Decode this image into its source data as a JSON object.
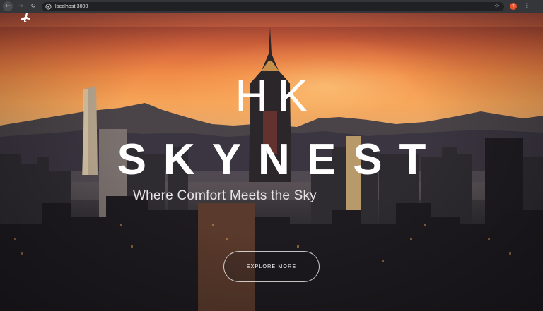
{
  "browser": {
    "url": "localhost:3000",
    "profile_initial": "T",
    "icons": [
      "back-arrow-icon",
      "forward-arrow-icon",
      "reload-icon",
      "site-info-icon",
      "star-icon",
      "profile-avatar",
      "more-menu-icon"
    ],
    "profile_color": "#e8542e"
  },
  "hero": {
    "title_line1": "HK",
    "title_line2": "SKYNEST",
    "tagline": "Where Comfort Meets the Sky",
    "cta_label": "EXPLORE MORE"
  },
  "nav": {
    "logo_icon": "airplane-icon"
  },
  "colors": {
    "text": "#ffffff",
    "sky_top": "#a04a3a",
    "sky_mid": "#f08a46"
  }
}
